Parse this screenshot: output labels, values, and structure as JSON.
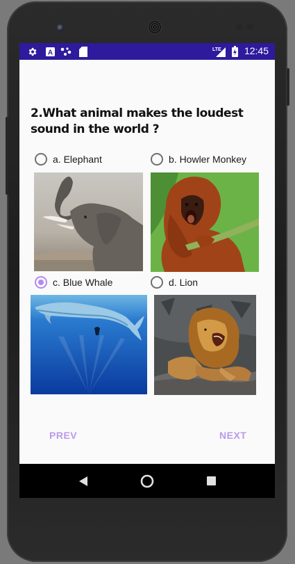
{
  "statusbar": {
    "time": "12:45",
    "network": "LTE",
    "icons": [
      "gear-icon",
      "a-icon",
      "dots-icon",
      "sd-card-icon",
      "signal-icon",
      "battery-icon"
    ]
  },
  "question": {
    "text": "2.What animal makes the loudest sound in the world ?"
  },
  "options": [
    {
      "label": "a. Elephant",
      "checked": false,
      "image": "elephant-image"
    },
    {
      "label": "b. Howler Monkey",
      "checked": false,
      "image": "howler-monkey-image"
    },
    {
      "label": "c. Blue Whale",
      "checked": true,
      "image": "blue-whale-image"
    },
    {
      "label": "d. Lion",
      "checked": false,
      "image": "lion-image"
    }
  ],
  "buttons": {
    "prev": "PREV",
    "next": "NEXT"
  },
  "colors": {
    "statusbar": "#2e1a9c",
    "accent": "#b48af0",
    "button_text": "#b99aea"
  }
}
